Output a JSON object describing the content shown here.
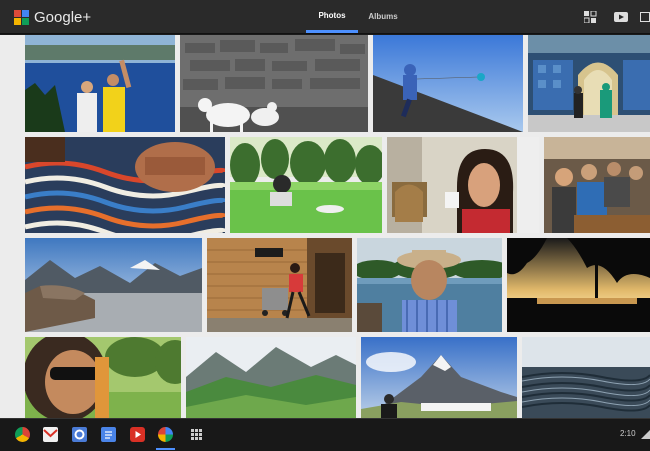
{
  "app": {
    "logo_text": "Google+"
  },
  "nav": {
    "tabs": [
      {
        "label": "Photos",
        "selected": true
      },
      {
        "label": "Albums",
        "selected": false
      }
    ]
  },
  "header_icons": [
    "grid-select-icon",
    "youtube-icon",
    "window-icon"
  ],
  "taskbar": {
    "apps": [
      "chrome-icon",
      "gmail-icon",
      "google-search-icon",
      "docs-icon",
      "youtube-icon",
      "google-photos-icon",
      "apps-launcher-icon"
    ],
    "clock": "2:10"
  },
  "colors": {
    "topbar": "#2a2a2a",
    "accent": "#4d90fe",
    "grid_background": "#ececec"
  }
}
